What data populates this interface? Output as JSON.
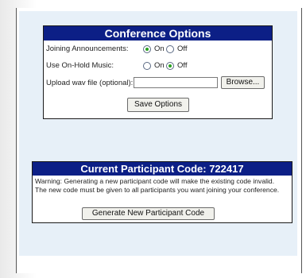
{
  "conference_options": {
    "title": "Conference Options",
    "joining_announcements": {
      "label": "Joining Announcements:",
      "on": "On",
      "off": "Off",
      "selected": "On"
    },
    "on_hold_music": {
      "label": "Use On-Hold Music:",
      "on": "On",
      "off": "Off",
      "selected": "Off"
    },
    "upload": {
      "label": "Upload wav file (optional):",
      "value": "",
      "browse_label": "Browse..."
    },
    "save_label": "Save Options"
  },
  "participant_code": {
    "title": "Current Participant Code: 722417",
    "warning_line1": "Warning: Generating a new participant code will make the existing code invalid.",
    "warning_line2": "The new code must be given to all participants you want joining your conference.",
    "generate_label": "Generate New Participant Code"
  },
  "colors": {
    "panel_header_bg": "#0c1f86",
    "page_bg": "#e7f0f8",
    "radio_selected": "#2aa21f"
  }
}
